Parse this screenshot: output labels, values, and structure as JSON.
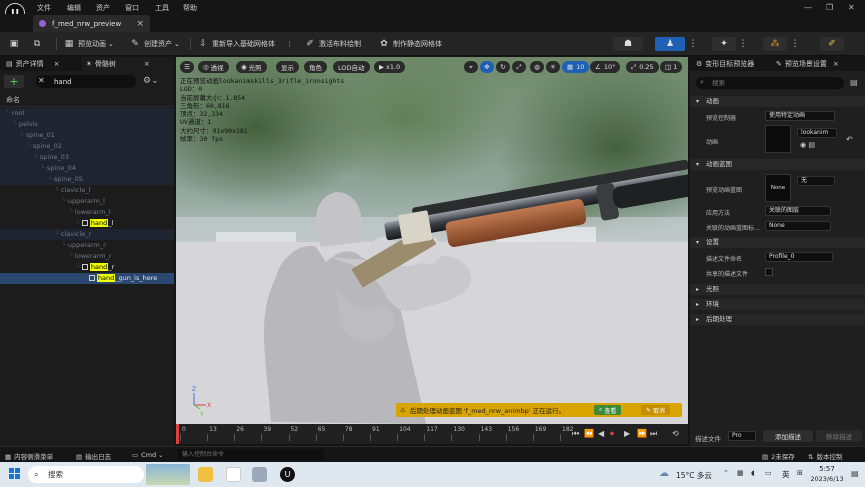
{
  "menu": [
    "文件",
    "编辑",
    "资产",
    "窗口",
    "工具",
    "帮助"
  ],
  "tab": {
    "title": "f_med_nrw_preview",
    "close": "×"
  },
  "window_controls": [
    "—",
    "❐",
    "✕"
  ],
  "toolbar": {
    "preview_anim": "预览动画",
    "create_asset": "创建资产",
    "reimport_mesh": "重新导入基础网格体",
    "cloth_paint": "激活布料绘制",
    "make_static_mesh": "制作静态网格体"
  },
  "left_panel": {
    "tabs": [
      "资产详情",
      "骨骼树"
    ],
    "search_value": "hand",
    "name_header": "命名",
    "tree": [
      {
        "label": "root",
        "indent": 0,
        "match": true
      },
      {
        "label": "pelvis",
        "indent": 1,
        "match": true
      },
      {
        "label": "spine_01",
        "indent": 2,
        "match": true
      },
      {
        "label": "spine_02",
        "indent": 3,
        "match": true
      },
      {
        "label": "spine_03",
        "indent": 4,
        "match": true
      },
      {
        "label": "spine_04",
        "indent": 5,
        "match": true
      },
      {
        "label": "spine_05",
        "indent": 6,
        "match": true
      },
      {
        "label": "clavicle_l",
        "indent": 7,
        "match": false
      },
      {
        "label": "upperarm_l",
        "indent": 8,
        "match": false
      },
      {
        "label": "lowerarm_l",
        "indent": 9,
        "match": false
      },
      {
        "label": "hand_l",
        "highlight": "hand",
        "rest": "_l",
        "indent": 10,
        "match": false
      },
      {
        "label": "clavicle_r",
        "indent": 7,
        "match": true
      },
      {
        "label": "upperarm_r",
        "indent": 8,
        "match": false
      },
      {
        "label": "lowerarm_r",
        "indent": 9,
        "match": false
      },
      {
        "label": "hand_r",
        "highlight": "hand",
        "rest": "_r",
        "indent": 10,
        "match": false
      },
      {
        "label": "hand_gun_is_here",
        "highlight": "hand",
        "rest": "_gun_is_here",
        "indent": 11,
        "match": false,
        "selected": true
      }
    ]
  },
  "viewport": {
    "buttons": [
      "透视",
      "光照",
      "显示",
      "角色",
      "LOD自动",
      "x1.0"
    ],
    "right_buttons": [
      "10",
      "10°",
      "0.25",
      "1"
    ],
    "stats": [
      "正在预览动画lookanimskills_3rifle_ironsights",
      "LOD：0",
      "当前屏幕大小：1.854",
      "三角形：60,816",
      "顶点：32,334",
      "UV通道：1",
      "大约尺寸：91x90x181",
      "帧率：30 fps"
    ],
    "notice": {
      "text": "后期处理动画蓝图 'f_med_nrw_animbp' 正在运行。",
      "view": "查看",
      "cancel": "取消"
    }
  },
  "timeline": {
    "ticks": [
      "0",
      "13",
      "26",
      "39",
      "52",
      "65",
      "78",
      "91",
      "104",
      "117",
      "130",
      "143",
      "156",
      "169",
      "182"
    ]
  },
  "right_panel": {
    "tabs": [
      "变形目标预览器",
      "预览场景设置"
    ],
    "search_placeholder": "搜索",
    "sections": {
      "animation": "动画",
      "preview_controller_label": "预览控制器",
      "preview_controller_value": "使用特定动画",
      "anim_label": "动画",
      "anim_value": "lookanim",
      "anim_blueprint": "动画蓝图",
      "preview_bp_label": "预览动画蓝图",
      "preview_bp_value": "无",
      "preview_bp_thumb": "None",
      "apply_method_label": "应用方法",
      "apply_method_value": "关联的图层",
      "linked_layer_label": "关联的动画蓝图标…",
      "linked_layer_value": "None",
      "settings": "设置",
      "profile_label": "描述文件命名",
      "profile_value": "Profile_0",
      "shared_profile_label": "共享的描述文件",
      "light": "光照",
      "environment": "环境",
      "post_process": "后期处理"
    },
    "footer": {
      "profile_label": "描述文件",
      "profile_value": "Pro",
      "add": "添加描述",
      "remove": "移除描述"
    }
  },
  "statusbar": {
    "drawer": "内容侧滑菜单",
    "output_log": "输出日志",
    "cmd": "Cmd",
    "cmd_placeholder": "输入控制台命令",
    "unsaved": "2未保存",
    "source_control": "版本控制"
  },
  "taskbar": {
    "search": "搜索",
    "weather": "15°C 多云",
    "lang": "英",
    "time": "5:57",
    "date": "2023/6/13"
  }
}
